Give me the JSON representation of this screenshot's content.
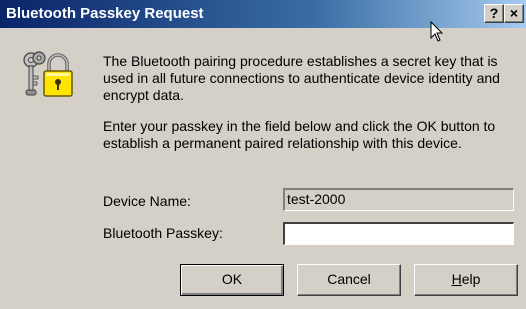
{
  "window": {
    "title": "Bluetooth Passkey Request",
    "help_button": "?",
    "close_button": "×"
  },
  "body": {
    "paragraph1": "The Bluetooth pairing procedure establishes a secret key that is used in all future connections to authenticate device identity and encrypt data.",
    "paragraph2": "Enter your passkey in the field below and click the OK button to establish a permanent paired relationship with this device."
  },
  "form": {
    "device_name_label": "Device Name:",
    "device_name_value": "test-2000",
    "passkey_label": "Bluetooth Passkey:",
    "passkey_value": ""
  },
  "buttons": {
    "ok": "OK",
    "cancel": "Cancel",
    "help_mnemonic": "H",
    "help_rest": "elp"
  },
  "colors": {
    "titlebar_start": "#0a246a",
    "titlebar_end": "#a6caf0",
    "dialog_face": "#d4d0c8"
  },
  "icons": {
    "dialog": "keys-and-padlock-icon",
    "cursor": "mouse-pointer-icon"
  }
}
